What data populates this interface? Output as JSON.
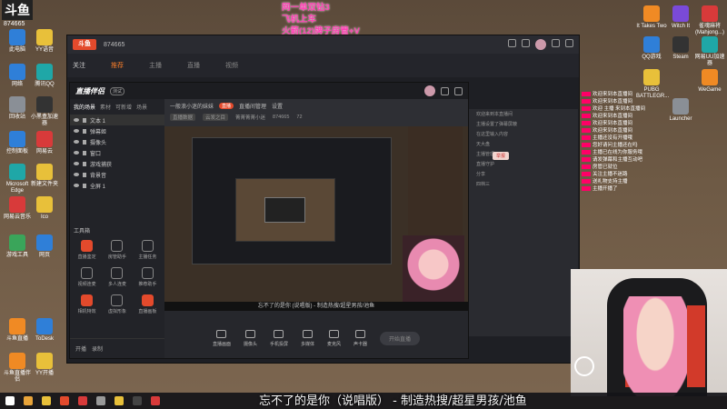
{
  "logo": {
    "text": "斗鱼",
    "room_number": "874665"
  },
  "overlay": {
    "lines": [
      "网一单双钻3",
      "飞机上车",
      "火箭(12)牌子房管+V"
    ]
  },
  "desktop_left": [
    {
      "label": "此电脑",
      "color": "blue"
    },
    {
      "label": "YY语音",
      "color": "yellow"
    },
    {
      "label": "网络",
      "color": "blue"
    },
    {
      "label": "腾讯QQ",
      "color": "teal"
    },
    {
      "label": "回收站",
      "color": "grey"
    },
    {
      "label": "小黑盒加速器",
      "color": "dark"
    },
    {
      "label": "控制面板",
      "color": "blue"
    },
    {
      "label": "网易云",
      "color": "red"
    },
    {
      "label": "Microsoft Edge",
      "color": "teal"
    },
    {
      "label": "新建文件夹",
      "color": "yellow"
    },
    {
      "label": "网易云音乐",
      "color": "red"
    },
    {
      "label": "Ico",
      "color": "yellow"
    },
    {
      "label": "游戏工具",
      "color": "green"
    },
    {
      "label": "网页",
      "color": "blue"
    },
    {
      "label": "斗鱼直播",
      "color": "orange"
    },
    {
      "label": "ToDesk",
      "color": "blue"
    },
    {
      "label": "斗鱼直播伴侣",
      "color": "orange"
    },
    {
      "label": "YY开播",
      "color": "yellow"
    }
  ],
  "desktop_right": [
    {
      "label": "It Takes Two",
      "color": "orange"
    },
    {
      "label": "Witch It",
      "color": "purple"
    },
    {
      "label": "雀魂麻将 (Mahjong...)",
      "color": "red"
    },
    {
      "label": "QQ游戏",
      "color": "blue"
    },
    {
      "label": "Steam",
      "color": "dark"
    },
    {
      "label": "网易UU加速器",
      "color": "teal"
    },
    {
      "label": "PUBG BATTLEGR...",
      "color": "yellow"
    },
    {
      "label": "WeGame",
      "color": "orange"
    },
    {
      "label": "Launcher",
      "color": "grey"
    }
  ],
  "main_window": {
    "title_room": "874665",
    "follow_label": "关注",
    "tabs": [
      "推荐",
      "主播",
      "直播",
      "视频"
    ],
    "active_tab": 0
  },
  "tool_window": {
    "app_name": "直播伴侣",
    "badge": "测试",
    "side_tabs": [
      "我的场景",
      "素材",
      "可新增",
      "场景"
    ],
    "scenes": [
      "文本 1",
      "弹幕姬",
      "摄像头",
      "窗口",
      "游戏捕获",
      "背景音",
      "全屏 1"
    ],
    "tools_title": "工具箱",
    "tools": [
      {
        "label": "直播鉴定",
        "hot": true
      },
      {
        "label": "房管助手",
        "hot": false
      },
      {
        "label": "主播任务",
        "hot": false
      },
      {
        "label": "视频连麦",
        "hot": false
      },
      {
        "label": "多人连麦",
        "hot": false
      },
      {
        "label": "推荐助手",
        "hot": false
      },
      {
        "label": "相机特效",
        "hot": true
      },
      {
        "label": "虚拟形象",
        "hot": false
      },
      {
        "label": "直播画板",
        "hot": true
      }
    ],
    "bottom": {
      "start": "开播",
      "mode": "录制"
    },
    "room_title": "一般浪小迷的妹妹",
    "live_tag": "直播",
    "room_meta": [
      "直播间管理",
      "设置"
    ],
    "room_meta2": [
      "直播数据",
      "云发之目",
      "菁菁菁菁小迷",
      "874665",
      "72"
    ],
    "song_title": "忘不了的是你 (说唱版) - 制造热搜/超星男孩/池鱼",
    "toolbar": [
      "直播画面",
      "摄像头",
      "手机投屏",
      "多媒体",
      "麦克风",
      "声卡器"
    ],
    "go_live_label": "开始直播"
  },
  "chat_panel": {
    "items": [
      "欢迎来到本直播间",
      "主播设置了弹幕屏蔽",
      "在这里输入内容",
      "天大盘",
      "主播管理",
      "直播守护",
      "分享",
      "四档三"
    ],
    "button": "举报"
  },
  "right_chat": [
    "欢迎来到本直播间",
    "欢迎来到本直播间",
    "欢迎 主播 来到本直播间",
    "欢迎来到本直播间",
    "欢迎来到本直播间",
    "欢迎来到本直播间",
    "主播还没有开播哦",
    "您好请问主播还在吗",
    "主播已在线为你服务哦",
    "请发弹幕和主播互动吧",
    "房管已就位",
    "关注主播不迷路",
    "送礼物支持主播",
    "主播开播了"
  ],
  "caption": "忘不了的是你（说唱版） - 制造热搜/超星男孩/池鱼"
}
